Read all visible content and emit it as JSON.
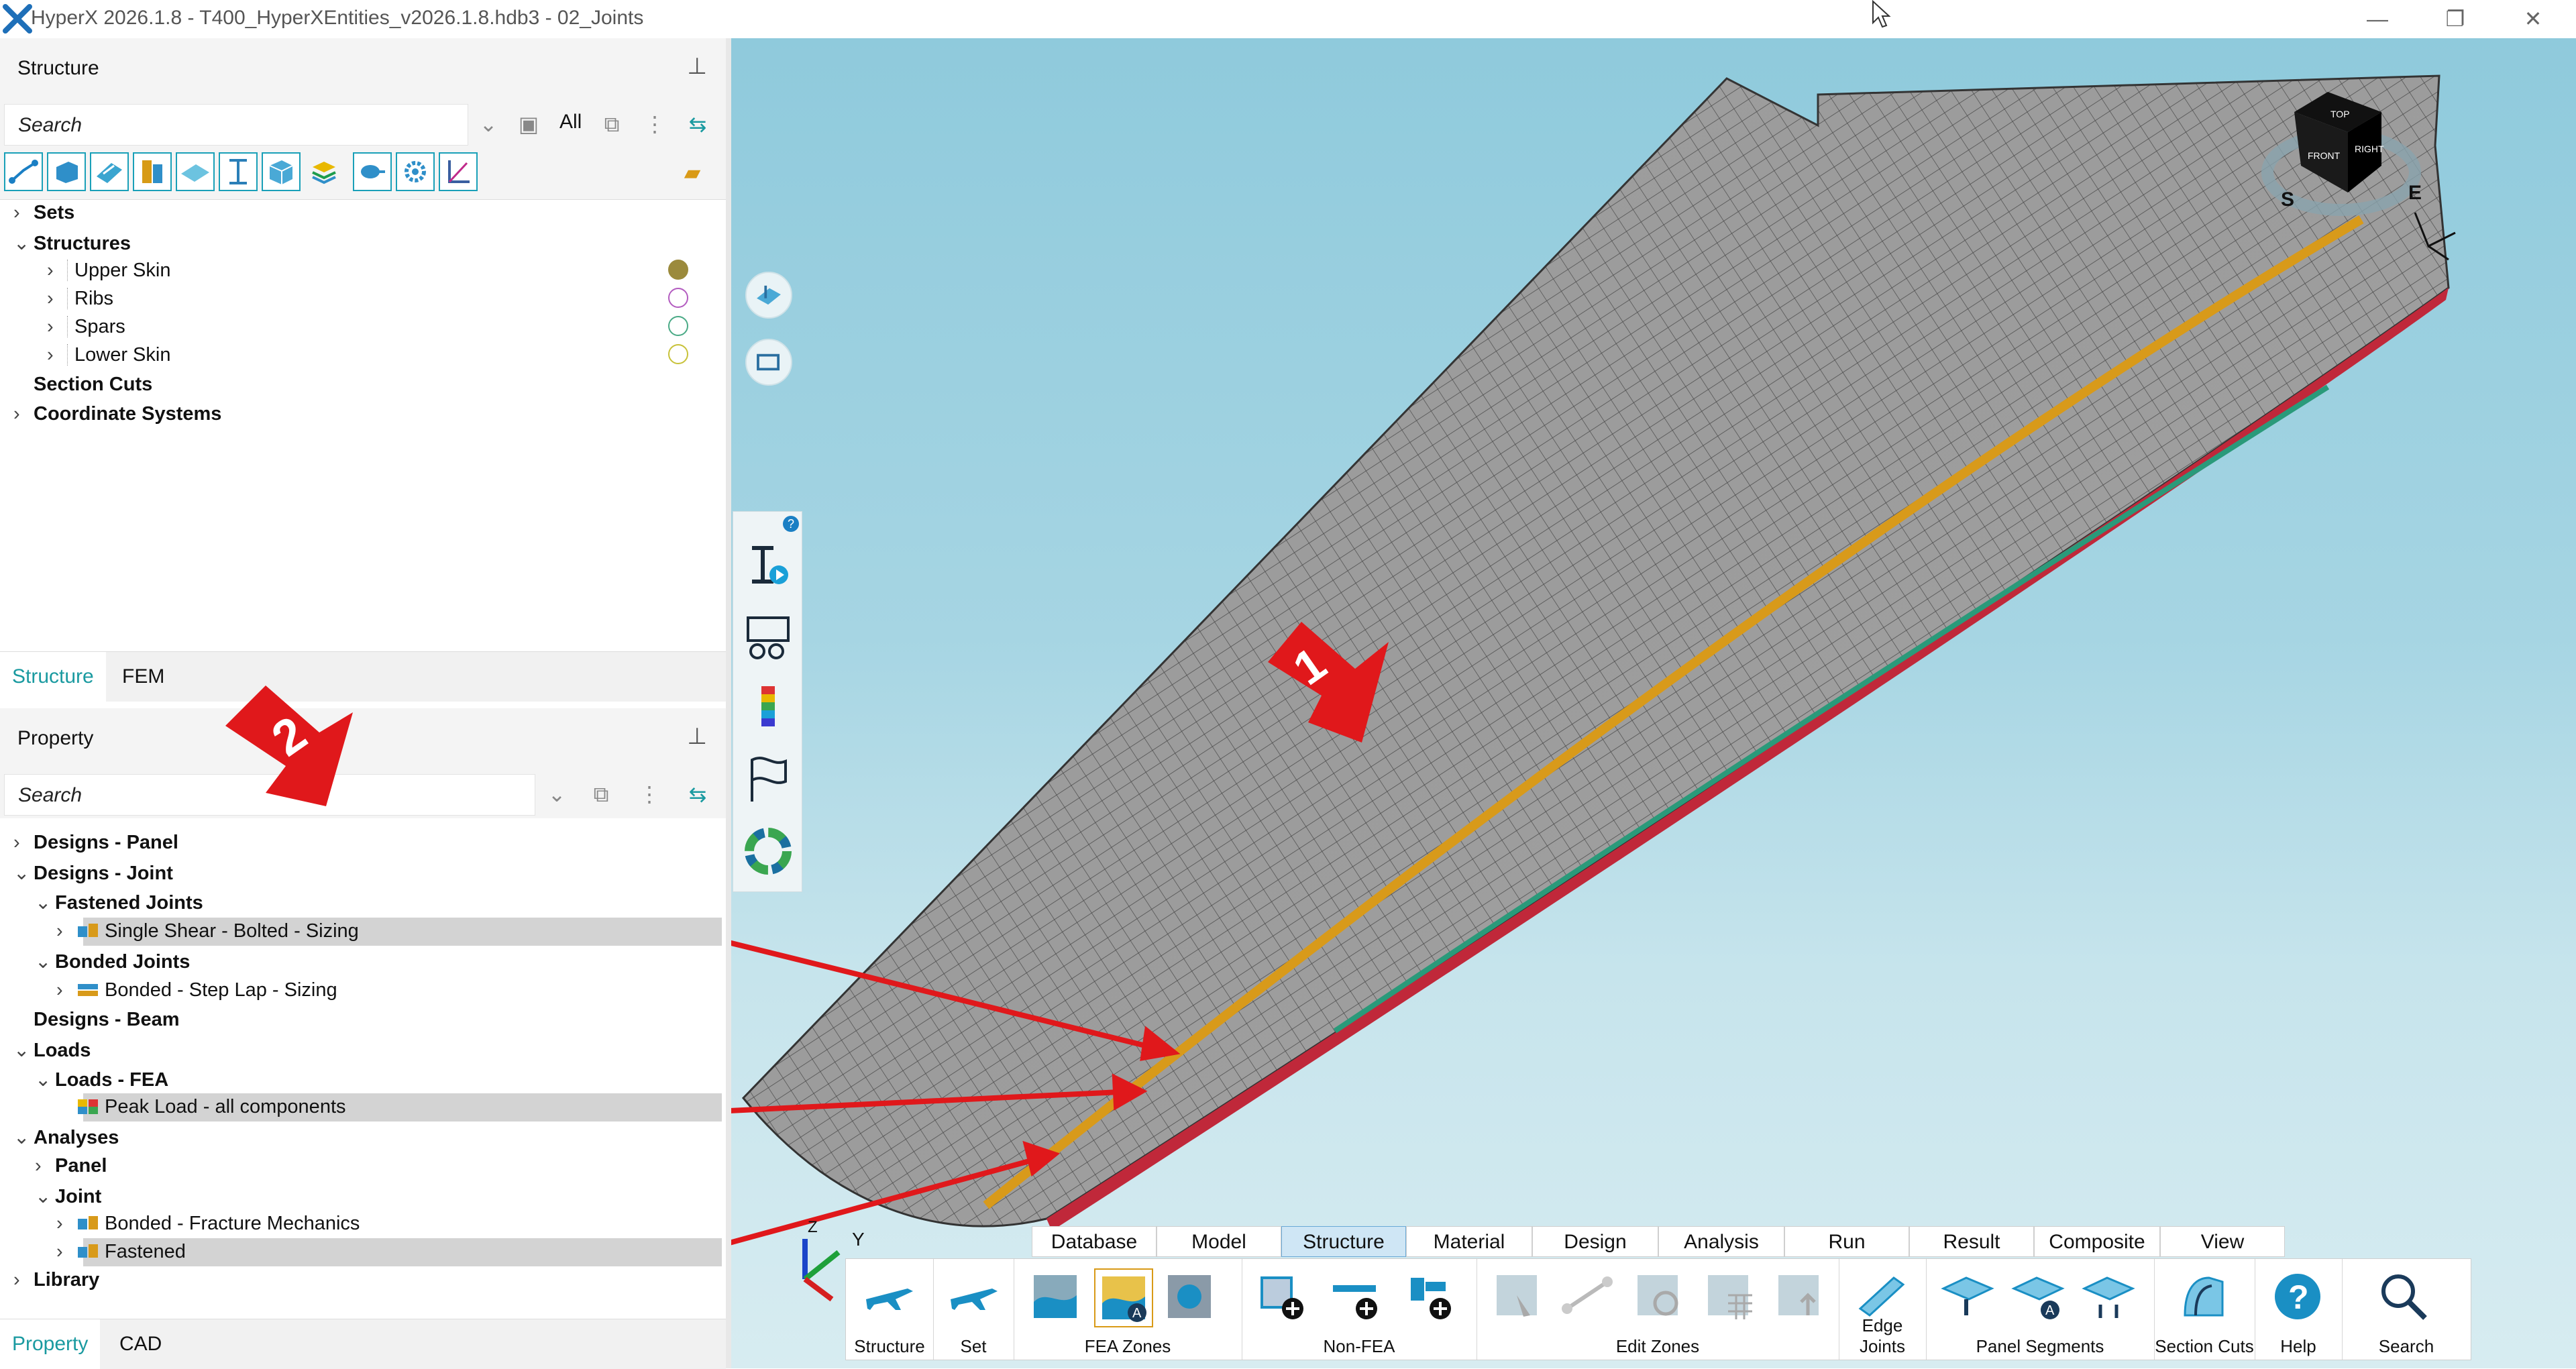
{
  "window": {
    "title": "HyperX 2026.1.8 - T400_HyperXEntities_v2026.1.8.hdb3 - 02_Joints",
    "controls": [
      "—",
      "❐",
      "✕"
    ]
  },
  "structure_panel": {
    "title": "Structure",
    "search_placeholder": "Search",
    "all_label": "All",
    "tree": [
      {
        "label": "Sets",
        "level": 0,
        "caret": "›",
        "bold": true
      },
      {
        "label": "Structures",
        "level": 0,
        "caret": "⌄",
        "bold": true
      },
      {
        "label": "Upper Skin",
        "level": 1,
        "caret": "›",
        "bold": false,
        "color": "#9b8a3c",
        "filled": true
      },
      {
        "label": "Ribs",
        "level": 1,
        "caret": "›",
        "bold": false,
        "color": "#b35cc0",
        "filled": false
      },
      {
        "label": "Spars",
        "level": 1,
        "caret": "›",
        "bold": false,
        "color": "#4aaa86",
        "filled": false
      },
      {
        "label": "Lower Skin",
        "level": 1,
        "caret": "›",
        "bold": false,
        "color": "#c8c23a",
        "filled": false
      },
      {
        "label": "Section Cuts",
        "level": 0,
        "caret": "",
        "bold": true
      },
      {
        "label": "Coordinate Systems",
        "level": 0,
        "caret": "›",
        "bold": true
      }
    ],
    "tabs": [
      "Structure",
      "FEM"
    ]
  },
  "property_panel": {
    "title": "Property",
    "search_placeholder": "Search",
    "tree": [
      {
        "label": "Designs - Panel",
        "level": 0,
        "caret": "›",
        "bold": true
      },
      {
        "label": "Designs - Joint",
        "level": 0,
        "caret": "⌄",
        "bold": true
      },
      {
        "label": "Fastened Joints",
        "level": 1,
        "caret": "⌄",
        "bold": true
      },
      {
        "label": "Single Shear - Bolted - Sizing",
        "level": 2,
        "caret": "›",
        "bold": false,
        "icon": "bolted-joint-icon",
        "highlight": true
      },
      {
        "label": "Bonded Joints",
        "level": 1,
        "caret": "⌄",
        "bold": true
      },
      {
        "label": "Bonded - Step Lap - Sizing",
        "level": 2,
        "caret": "›",
        "bold": false,
        "icon": "bonded-joint-icon"
      },
      {
        "label": "Designs - Beam",
        "level": 0,
        "caret": "",
        "bold": true
      },
      {
        "label": "Loads",
        "level": 0,
        "caret": "⌄",
        "bold": true
      },
      {
        "label": "Loads - FEA",
        "level": 1,
        "caret": "⌄",
        "bold": true
      },
      {
        "label": "Peak Load - all components",
        "level": 2,
        "caret": "",
        "bold": false,
        "icon": "load-icon",
        "highlight": true
      },
      {
        "label": "Analyses",
        "level": 0,
        "caret": "⌄",
        "bold": true
      },
      {
        "label": "Panel",
        "level": 1,
        "caret": "›",
        "bold": true
      },
      {
        "label": "Joint",
        "level": 1,
        "caret": "⌄",
        "bold": true
      },
      {
        "label": "Bonded - Fracture Mechanics",
        "level": 2,
        "caret": "›",
        "bold": false,
        "icon": "bolted-joint-icon"
      },
      {
        "label": "Fastened",
        "level": 2,
        "caret": "›",
        "bold": false,
        "icon": "bolted-joint-icon",
        "highlight": true
      },
      {
        "label": "Library",
        "level": 0,
        "caret": "›",
        "bold": true
      }
    ],
    "tabs": [
      "Property",
      "CAD"
    ]
  },
  "callouts": [
    "1",
    "2"
  ],
  "view_cube": {
    "faces": [
      "TOP",
      "FRONT",
      "RIGHT"
    ],
    "compass": [
      "S",
      "E"
    ]
  },
  "axis_triad": [
    "Y",
    "Z"
  ],
  "ribbon": {
    "tabs": [
      "Database",
      "Model",
      "Structure",
      "Material",
      "Design",
      "Analysis",
      "Run",
      "Result",
      "Composite",
      "View"
    ],
    "active_tab": "Structure",
    "groups": [
      "Structure",
      "Set",
      "FEA Zones",
      "Non-FEA",
      "Edit Zones",
      "Edge Joints",
      "Panel Segments",
      "Section Cuts",
      "Help",
      "Search"
    ]
  },
  "colors": {
    "accent": "#1a9aa0",
    "callout": "#e0181b",
    "joint_line": "#d89a1a"
  }
}
